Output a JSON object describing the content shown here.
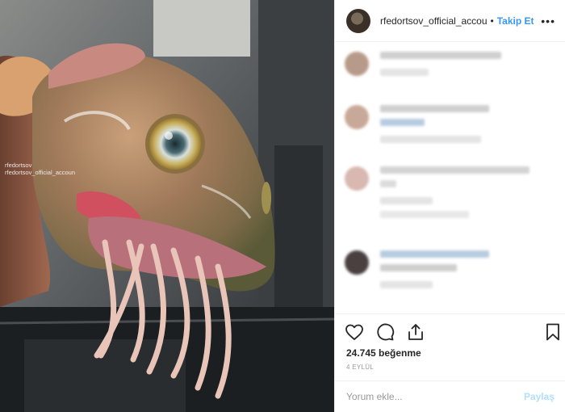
{
  "header": {
    "username": "rfedortsov_official_accou",
    "separator": "•",
    "follow_label": "Takip Et",
    "more_label": "•••"
  },
  "photo": {
    "watermark_handle": "rfedortsov",
    "watermark_account": "rfedortsov_official_accoun"
  },
  "actions": {
    "like_icon": "heart-icon",
    "comment_icon": "comment-icon",
    "share_icon": "share-icon",
    "save_icon": "bookmark-icon"
  },
  "likes": {
    "text": "24.745 beğenme"
  },
  "date": {
    "text": "4 EYLÜL"
  },
  "comment_box": {
    "placeholder": "Yorum ekle...",
    "post_label": "Paylaş"
  },
  "colors": {
    "accent": "#3897f0",
    "post_disabled": "#b2dffc",
    "text": "#262626",
    "muted": "#999999",
    "border": "#efefef"
  }
}
